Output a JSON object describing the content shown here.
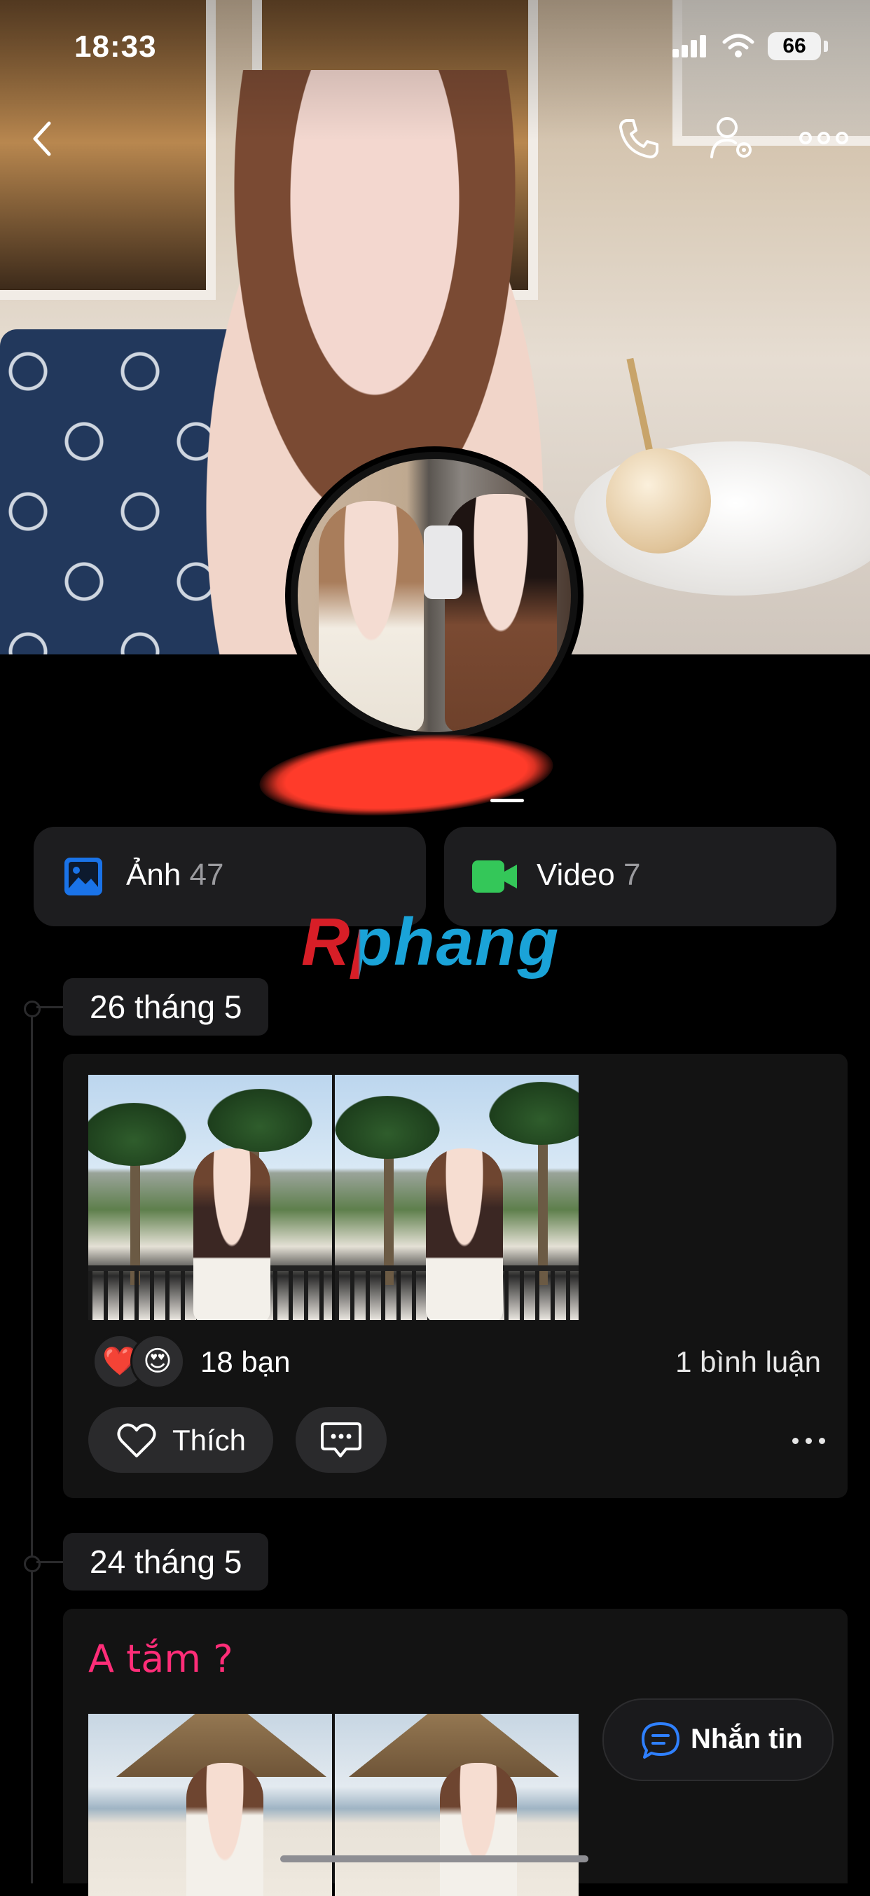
{
  "status_bar": {
    "time": "18:33",
    "battery": "66"
  },
  "profile": {
    "name_redacted": true
  },
  "albums": [
    {
      "label": "Ảnh",
      "count": "47",
      "icon": "photo-icon",
      "icon_color": "#1a73e8"
    },
    {
      "label": "Video",
      "count": "7",
      "icon": "video-camera-icon",
      "icon_color": "#34c759"
    }
  ],
  "watermark": {
    "text": "Rphang"
  },
  "timeline": [
    {
      "date": "26 tháng 5",
      "reactions": {
        "emojis": [
          "❤️",
          "😍"
        ],
        "count_text": "18 bạn"
      },
      "comments_text": "1 bình luận",
      "like_label": "Thích"
    },
    {
      "date": "24 tháng 5",
      "caption": "A tắm ?"
    }
  ],
  "fab": {
    "label": "Nhắn tin"
  },
  "colors": {
    "background": "#000000",
    "card": "#131313",
    "chip": "#1d1d1f",
    "caption": "#ff2d78",
    "watermark_red": "#d71e27",
    "watermark_blue": "#1aa3d8"
  }
}
